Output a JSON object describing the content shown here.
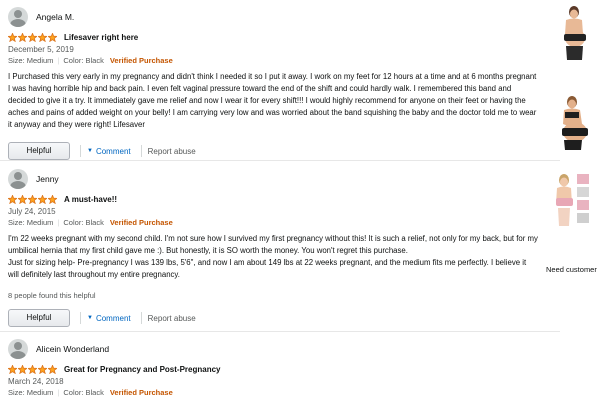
{
  "reviews": [
    {
      "reviewer": "Angela M.",
      "rating": 5,
      "title": "Lifesaver right here",
      "date": "December 5, 2019",
      "size": "Size: Medium",
      "color": "Color: Black",
      "verified": "Verified Purchase",
      "body": [
        "I Purchased this very early in my pregnancy and didn't think I needed it so I put it away. I work on my feet for 12 hours at a time and at 6 months pregnant I was having horrible hip and back pain. I even felt vaginal pressure toward the end of the shift and could hardly walk. I remembered this band and decided to give it a try. It immediately gave me relief and now I wear it for every shift!!! I would highly recommend for anyone on their feet or having the aches and pains of added weight on your belly! I am carrying very low and was worried about the band squishing the baby and the doctor told me to wear it anyway and they were right! Lifesaver"
      ],
      "helpful_count": "",
      "helpful_label": "Helpful",
      "comment_label": "Comment",
      "abuse_label": "Report abuse"
    },
    {
      "reviewer": "Jenny",
      "rating": 5,
      "title": "A must-have!!",
      "date": "July 24, 2015",
      "size": "Size: Medium",
      "color": "Color: Black",
      "verified": "Verified Purchase",
      "body": [
        "I'm 22 weeks pregnant with my second child. I'm not sure how I survived my first pregnancy without this! It is such a relief, not only for my back, but for my umbilical hernia that my first child gave me :). But honestly, it is SO worth the money. You won't regret this purchase.",
        "Just for sizing help- Pre-pregnancy I was 139 lbs, 5'6\", and now I am about 149 lbs at 22 weeks pregnant, and the medium fits me perfectly. I believe it will definitely last throughout my entire pregnancy."
      ],
      "helpful_count": "8 people found this helpful",
      "helpful_label": "Helpful",
      "comment_label": "Comment",
      "abuse_label": "Report abuse"
    },
    {
      "reviewer": "Alicein Wonderland",
      "rating": 5,
      "title": "Great for Pregnancy and Post-Pregnancy",
      "date": "March 24, 2018",
      "size": "Size: Medium",
      "color": "Color: Black",
      "verified": "Verified Purchase"
    }
  ],
  "sidebar": {
    "thumbnails": [
      "product-photo-belly-band-front",
      "product-photo-belly-band-side",
      "product-photo-belly-band-collage"
    ],
    "need_customer_text": "Need customer"
  },
  "colors": {
    "star": "#ffa41c",
    "link": "#0066c0",
    "verified": "#c45500"
  }
}
